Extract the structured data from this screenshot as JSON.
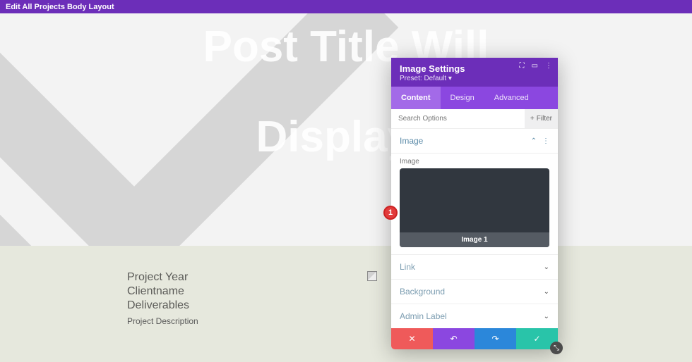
{
  "topbar": {
    "title": "Edit All Projects Body Layout"
  },
  "hero": {
    "line1": "Post Title Will",
    "line2": "Display I"
  },
  "content": {
    "line1": "Project Year",
    "line2": "Clientname",
    "line3": "Deliverables",
    "desc": "Project Description"
  },
  "panel": {
    "title": "Image Settings",
    "preset_label": "Preset: Default",
    "tabs": {
      "content": "Content",
      "design": "Design",
      "advanced": "Advanced"
    },
    "search_placeholder": "Search Options",
    "filter_label": "Filter",
    "sections": {
      "image": "Image",
      "image_field_label": "Image",
      "image_caption": "Image 1",
      "link": "Link",
      "background": "Background",
      "admin_label": "Admin Label"
    }
  },
  "annotation": {
    "num": "1"
  }
}
